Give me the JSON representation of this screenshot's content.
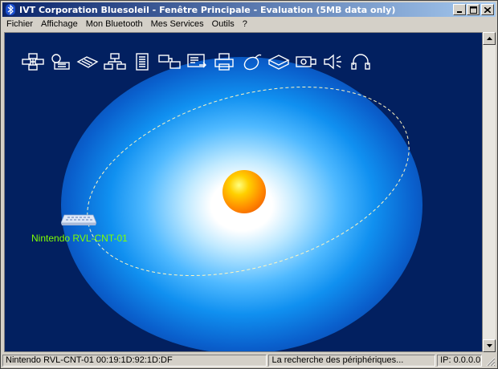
{
  "window": {
    "title": "IVT Corporation Bluesoleil - Fenêtre Principale - Evaluation (5MB data only)",
    "controls": [
      "minimize-icon",
      "maximize-icon",
      "close-icon"
    ]
  },
  "menu": {
    "items": [
      {
        "label": "Fichier"
      },
      {
        "label": "Affichage"
      },
      {
        "label": "Mon Bluetooth"
      },
      {
        "label": "Mes Services"
      },
      {
        "label": "Outils"
      },
      {
        "label": "?"
      }
    ]
  },
  "services": {
    "icons": [
      "personal-area-network-icon",
      "dial-up-networking-icon",
      "fax-icon",
      "lan-access-icon",
      "file-transfer-icon",
      "synchronization-icon",
      "object-push-icon",
      "printer-icon",
      "human-interface-device-icon",
      "basic-imaging-icon",
      "serial-port-icon",
      "audio-icon",
      "headset-icon"
    ]
  },
  "main": {
    "device_label": "Nintendo RVL-CNT-01",
    "background_color": "#022060",
    "label_color": "#80ff00"
  },
  "status": {
    "device": "Nintendo RVL-CNT-01  00:19:1D:92:1D:DF",
    "message": "La recherche des périphériques...",
    "ip": "IP: 0.0.0.0"
  }
}
